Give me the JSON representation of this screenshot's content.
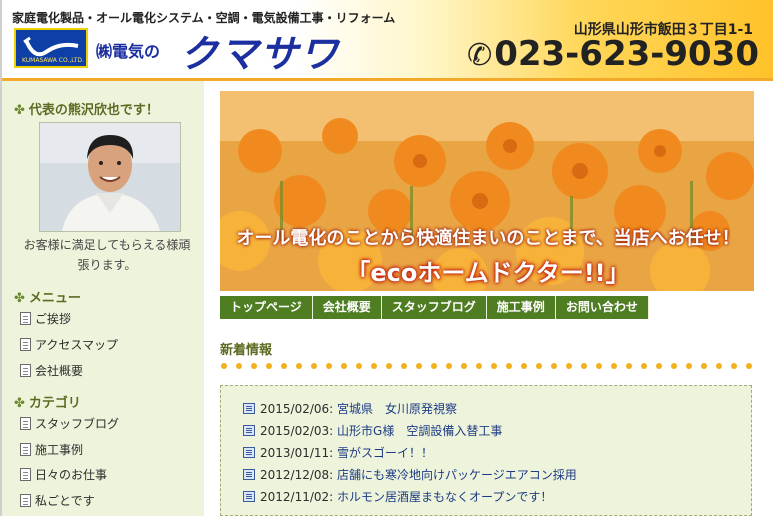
{
  "header": {
    "tagline": "家庭電化製品・オール電化システム・空調・電気設備工事・リフォーム",
    "logo_small": "KUMASAWA CO.,LTD.",
    "company_prefix": "㈱電気の",
    "company_name": "クマサワ",
    "address": "山形県山形市飯田３丁目1-1",
    "phone": "023-623-9030",
    "phone_icon": "phone-icon"
  },
  "sidebar": {
    "rep_title": "代表の熊沢欣也です！",
    "rep_message": "お客様に満足してもらえる様頑張ります。",
    "menu_title": "メニュー",
    "menu_items": [
      "ご挨拶",
      "アクセスマップ",
      "会社概要"
    ],
    "category_title": "カテゴリ",
    "category_items": [
      "スタッフブログ",
      "施工事例",
      "日々のお仕事",
      "私ごとです"
    ]
  },
  "hero": {
    "line1": "オール電化のことから快適住まいのことまで、当店へお任せ！",
    "line2": "「ecoホームドクター!!」"
  },
  "nav": {
    "items": [
      "トップページ",
      "会社概要",
      "スタッフブログ",
      "施工事例",
      "お問い合わせ"
    ]
  },
  "news": {
    "title": "新着情報",
    "items": [
      {
        "date": "2015/02/06:",
        "text": "宮城県　女川原発視察"
      },
      {
        "date": "2015/02/03:",
        "text": "山形市G様　空調設備入替工事"
      },
      {
        "date": "2013/01/11:",
        "text": "雪がスゴーイ！！"
      },
      {
        "date": "2012/12/08:",
        "text": "店舗にも寒冷地向けパッケージエアコン採用"
      },
      {
        "date": "2012/11/02:",
        "text": "ホルモン居酒屋まもなくオープンです！"
      }
    ]
  },
  "colors": {
    "brand_blue": "#1b2fa0",
    "nav_green": "#4e7d22",
    "sidebar_bg": "#eef4dc",
    "header_orange": "#ffc22a"
  }
}
